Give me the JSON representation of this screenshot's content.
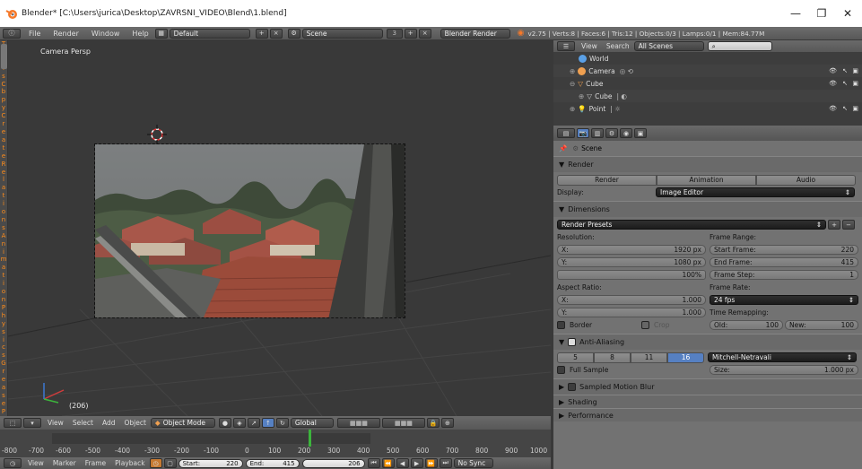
{
  "window": {
    "title": "Blender* [C:\\Users\\jurica\\Desktop\\ZAVRSNI_VIDEO\\Blend\\1.blend]",
    "minimize": "—",
    "maximize": "❐",
    "close": "✕"
  },
  "topbar": {
    "menus": [
      "File",
      "Render",
      "Window",
      "Help"
    ],
    "layout": "Default",
    "scene": "Scene",
    "scene_num": "3",
    "engine": "Blender Render",
    "stats": "v2.75 | Verts:8 | Faces:6 | Tris:12 | Objects:0/3 | Lamps:0/1 | Mem:84.77M"
  },
  "viewport": {
    "view_label": "Camera Persp",
    "frame_label": "(206)"
  },
  "lefttools_letters": [
    "T",
    "o",
    "o",
    "l",
    "s",
    "",
    "C",
    "",
    "",
    "b",
    "p",
    "y",
    "",
    "C",
    "r",
    "e",
    "a",
    "t",
    "e",
    "",
    "R",
    "e",
    "l",
    "a",
    "t",
    "i",
    "o",
    "n",
    "s",
    "",
    "A",
    "n",
    "i",
    "m",
    "a",
    "t",
    "i",
    "o",
    "n",
    "",
    "P",
    "h",
    "y",
    "s",
    "i",
    "c",
    "s",
    "",
    "G",
    "r",
    "e",
    "a",
    "s",
    "e",
    "",
    "P",
    "e",
    "n",
    "c",
    "i",
    "l"
  ],
  "viewheader": {
    "menus": [
      "View",
      "Select",
      "Add",
      "Object"
    ],
    "mode": "Object Mode",
    "orientation": "Global"
  },
  "timeline": {
    "ticks": [
      "-800",
      "-700",
      "-600",
      "-500",
      "-400",
      "-300",
      "-200",
      "-100",
      "0",
      "100",
      "200",
      "300",
      "400",
      "500",
      "600",
      "700",
      "800",
      "900",
      "1000"
    ]
  },
  "bottombar": {
    "menus": [
      "View",
      "Marker",
      "Frame",
      "Playback"
    ],
    "start_label": "Start:",
    "start_value": "220",
    "end_label": "End:",
    "end_value": "415",
    "current_value": "206",
    "sync": "No Sync"
  },
  "outliner": {
    "menus": [
      "View",
      "Search"
    ],
    "filter": "All Scenes",
    "rows": [
      {
        "label": "World",
        "color": "#5aa0e6"
      },
      {
        "label": "Camera",
        "color": "#f0a050"
      },
      {
        "label": "Cube",
        "color": "#f0a050"
      },
      {
        "label": "Cube",
        "color": "#d8d8d8"
      },
      {
        "label": "Point",
        "color": "#f0c050"
      }
    ]
  },
  "properties": {
    "context": "Scene",
    "render_panel": "Render",
    "render_buttons": [
      "Render",
      "Animation",
      "Audio"
    ],
    "display_label": "Display:",
    "display_value": "Image Editor",
    "dimensions_panel": "Dimensions",
    "presets": "Render Presets",
    "resolution_label": "Resolution:",
    "res_x_label": "X:",
    "res_x": "1920 px",
    "res_y_label": "Y:",
    "res_y": "1080 px",
    "res_pct": "100%",
    "aspect_label": "Aspect Ratio:",
    "asp_x_label": "X:",
    "asp_x": "1.000",
    "asp_y_label": "Y:",
    "asp_y": "1.000",
    "border": "Border",
    "crop": "Crop",
    "frame_range_label": "Frame Range:",
    "start_frame_label": "Start Frame:",
    "start_frame": "220",
    "end_frame_label": "End Frame:",
    "end_frame": "415",
    "frame_step_label": "Frame Step:",
    "frame_step": "1",
    "frame_rate_label": "Frame Rate:",
    "fps": "24 fps",
    "time_remap_label": "Time Remapping:",
    "old_label": "Old:",
    "old_value": "100",
    "new_label": "New:",
    "new_value": "100",
    "aa_panel": "Anti-Aliasing",
    "aa_samples": [
      "5",
      "8",
      "11",
      "16"
    ],
    "aa_filter": "Mitchell-Netravali",
    "full_sample": "Full Sample",
    "size_label": "Size:",
    "size_value": "1.000 px",
    "more_panels": [
      "Sampled Motion Blur",
      "Shading",
      "Performance"
    ]
  }
}
